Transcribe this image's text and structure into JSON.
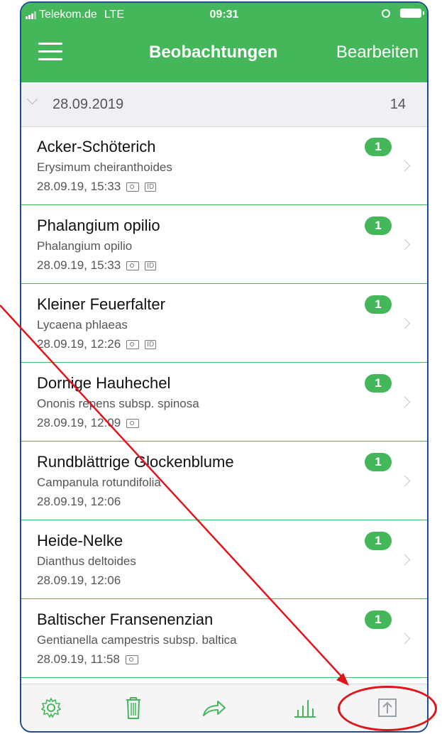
{
  "status": {
    "carrier": "Telekom.de",
    "network": "LTE",
    "time": "09:31",
    "alarm_icon": "alarm-icon",
    "battery_icon": "battery-icon"
  },
  "navbar": {
    "title": "Beobachtungen",
    "edit_label": "Bearbeiten",
    "menu_icon": "hamburger-icon"
  },
  "section": {
    "date": "28.09.2019",
    "count": "14"
  },
  "observations": [
    {
      "name": "Acker-Schöterich",
      "scientific": "Erysimum cheiranthoides",
      "timestamp": "28.09.19, 15:33",
      "camera": true,
      "id": true,
      "badge": "1"
    },
    {
      "name": "Phalangium opilio",
      "scientific": "Phalangium opilio",
      "timestamp": "28.09.19, 15:33",
      "camera": true,
      "id": true,
      "badge": "1"
    },
    {
      "name": "Kleiner Feuerfalter",
      "scientific": "Lycaena phlaeas",
      "timestamp": "28.09.19, 12:26",
      "camera": true,
      "id": true,
      "badge": "1"
    },
    {
      "name": "Dornige Hauhechel",
      "scientific": "Ononis repens subsp. spinosa",
      "timestamp": "28.09.19, 12:09",
      "camera": true,
      "id": false,
      "badge": "1"
    },
    {
      "name": "Rundblättrige Glockenblume",
      "scientific": "Campanula rotundifolia",
      "timestamp": "28.09.19, 12:06",
      "camera": false,
      "id": false,
      "badge": "1"
    },
    {
      "name": "Heide-Nelke",
      "scientific": "Dianthus deltoides",
      "timestamp": "28.09.19, 12:06",
      "camera": false,
      "id": false,
      "badge": "1"
    },
    {
      "name": "Baltischer Fransenenzian",
      "scientific": "Gentianella campestris subsp. baltica",
      "timestamp": "28.09.19, 11:58",
      "camera": true,
      "id": false,
      "badge": "1"
    }
  ],
  "id_label": "ID",
  "toolbar": {
    "items": [
      "settings-icon",
      "trash-icon",
      "share-icon",
      "statistics-icon",
      "upload-icon"
    ]
  },
  "colors": {
    "brand_green": "#43b75a",
    "annotation_red": "#e0151c",
    "frame_blue": "#1c4f8f"
  }
}
